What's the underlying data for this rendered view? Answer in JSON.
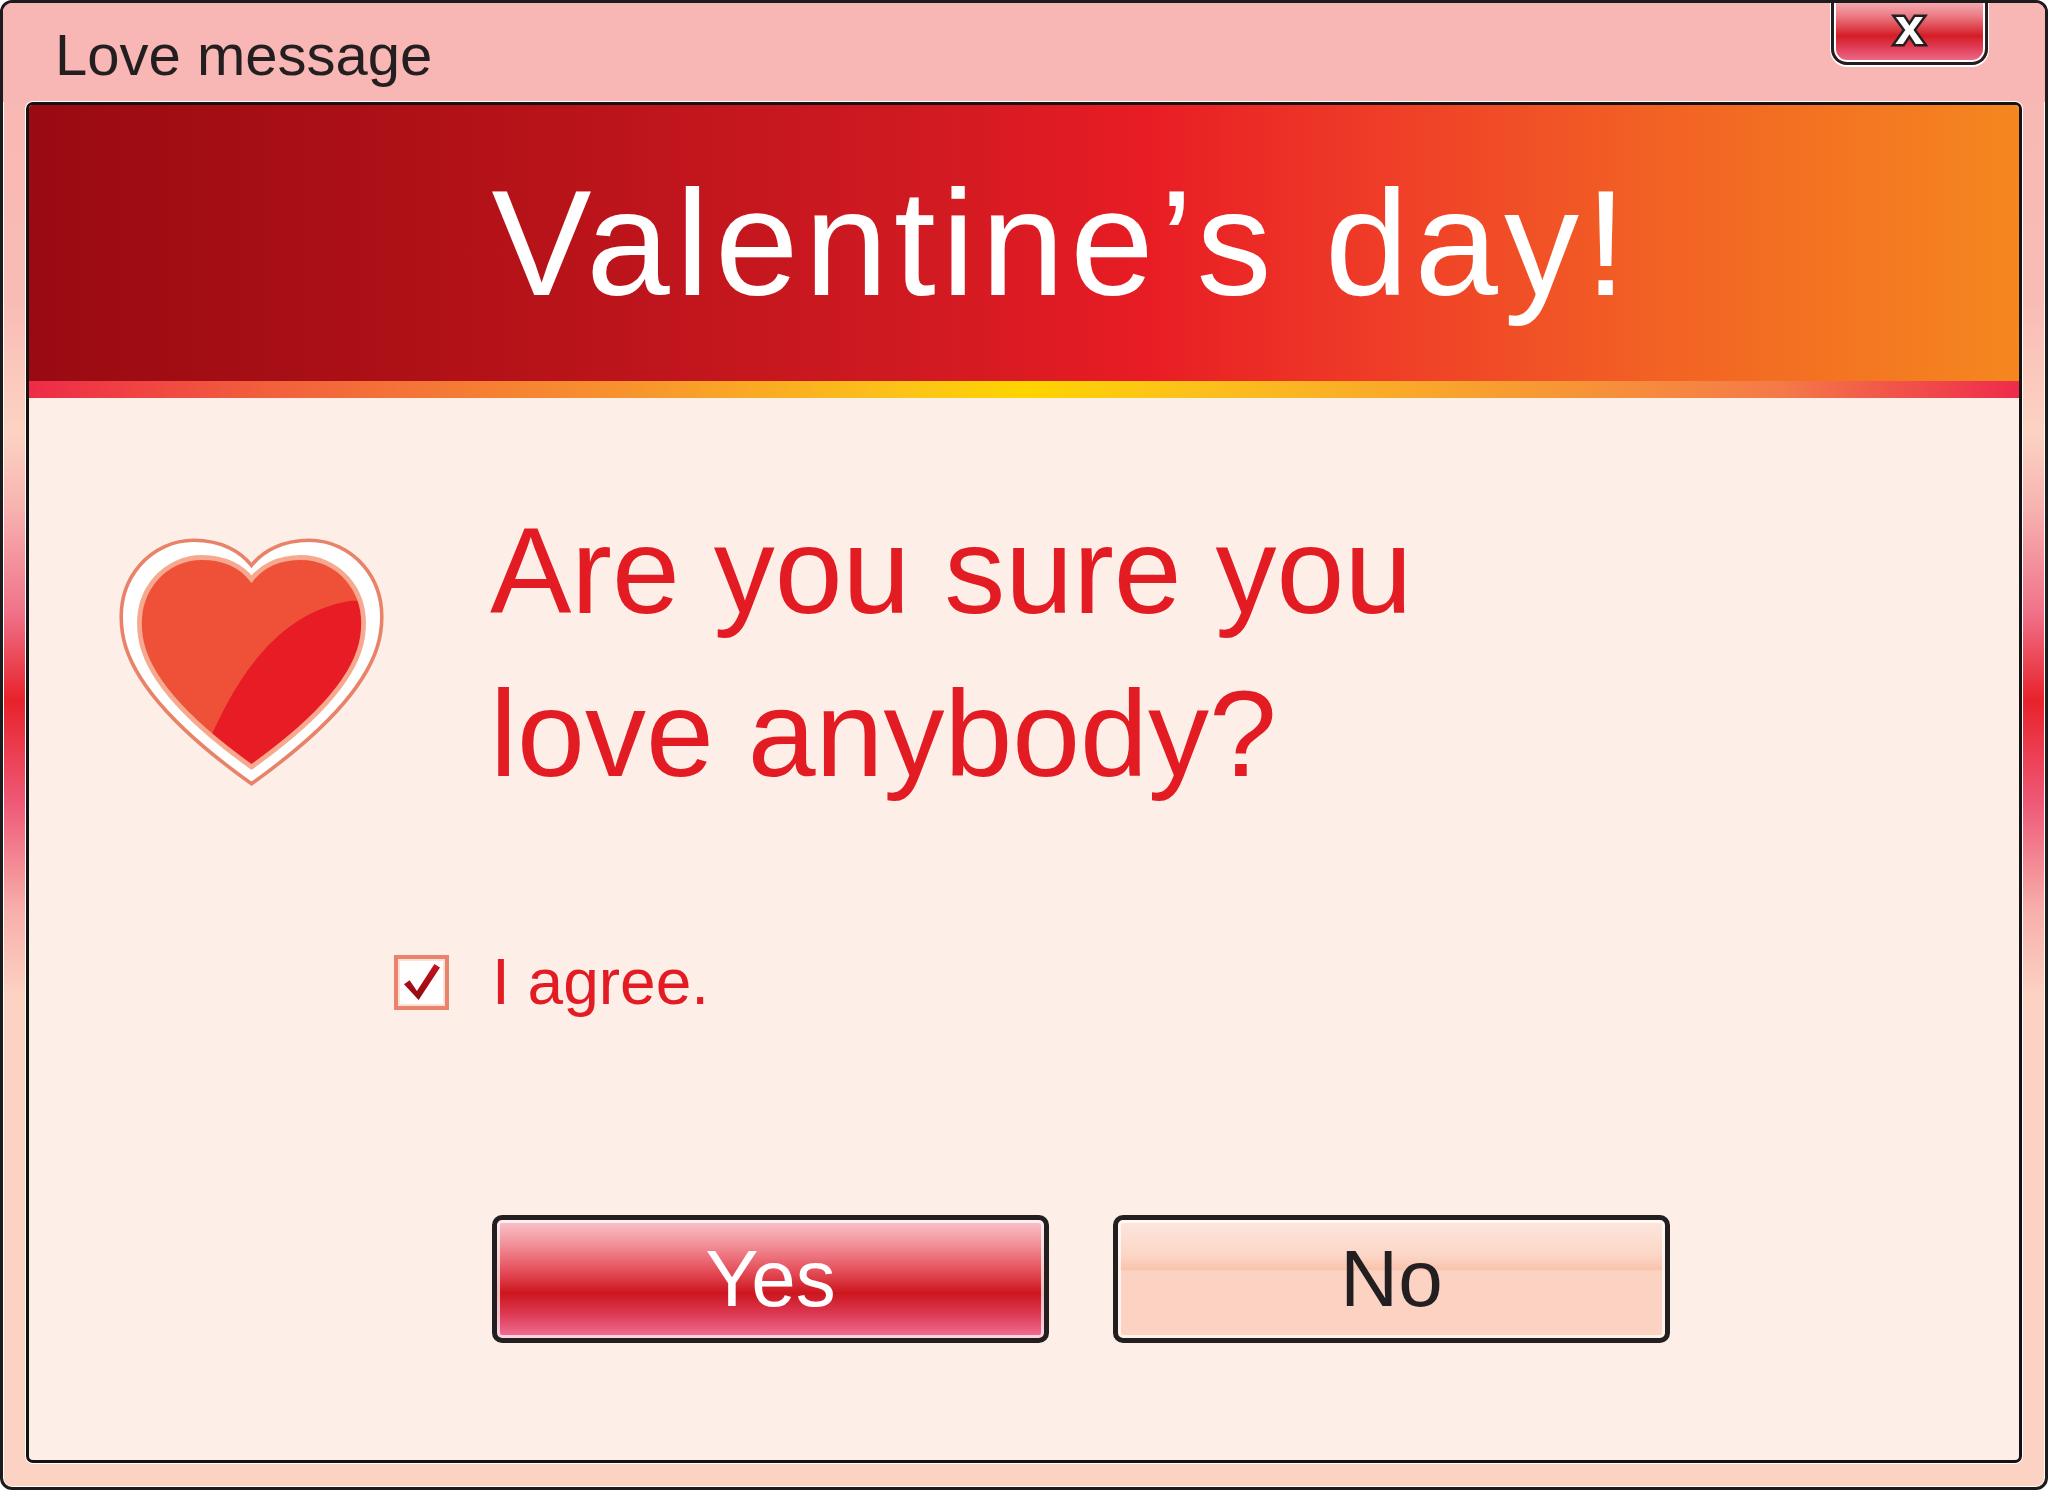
{
  "window": {
    "title": "Love message",
    "close_button": {
      "label": "x"
    }
  },
  "banner": {
    "title": "Valentine’s day!"
  },
  "question": "Are you sure you love anybody?",
  "agree": {
    "label": "I agree.",
    "checked": true
  },
  "buttons": [
    {
      "label": "Yes",
      "kind": "primary"
    },
    {
      "label": "No",
      "kind": "secondary"
    }
  ]
}
